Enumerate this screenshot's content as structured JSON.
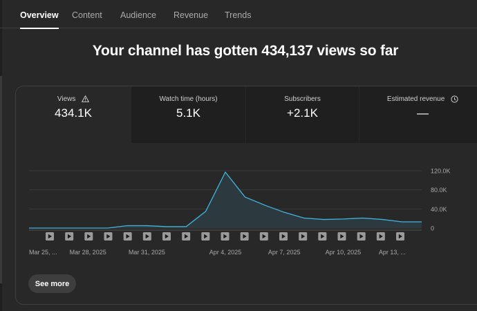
{
  "tabs": [
    {
      "label": "Overview",
      "active": true
    },
    {
      "label": "Content"
    },
    {
      "label": "Audience"
    },
    {
      "label": "Revenue"
    },
    {
      "label": "Trends"
    }
  ],
  "headline": "Your channel has gotten 434,137 views so far",
  "metrics": [
    {
      "label": "Views",
      "value": "434.1K",
      "icon": "warning-icon"
    },
    {
      "label": "Watch time (hours)",
      "value": "5.1K"
    },
    {
      "label": "Subscribers",
      "value": "+2.1K"
    },
    {
      "label": "Estimated revenue",
      "value": "—",
      "icon": "clock-icon"
    }
  ],
  "see_more_label": "See more",
  "colors": {
    "line": "#41b4de",
    "area": "#2c3c42",
    "grid": "#3b3b3b"
  },
  "chart_data": {
    "type": "area",
    "series": [
      {
        "values": [
          0,
          0,
          0,
          0,
          0,
          5000,
          5000,
          3000,
          3000,
          35000,
          117000,
          65000,
          48000,
          33000,
          21000,
          18000,
          19000,
          21000,
          18000,
          13000,
          13000
        ]
      }
    ],
    "y_ticks": [
      "0",
      "40.0K",
      "80.0K",
      "120.0K"
    ],
    "y_tick_values": [
      0,
      40000,
      80000,
      120000
    ],
    "ylim": [
      0,
      120000
    ],
    "x_labels": [
      "Mar 25, ...",
      "Mar 28, 2025",
      "Mar 31, 2025",
      "Apr 4, 2025",
      "Apr 7, 2025",
      "Apr 10, 2025",
      "Apr 13, ..."
    ],
    "x_label_indices": [
      0,
      3,
      6,
      10,
      13,
      16,
      18.5
    ],
    "markers": 19,
    "marker_icon": "play-icon",
    "grid": true,
    "y_axis_position": "right"
  }
}
